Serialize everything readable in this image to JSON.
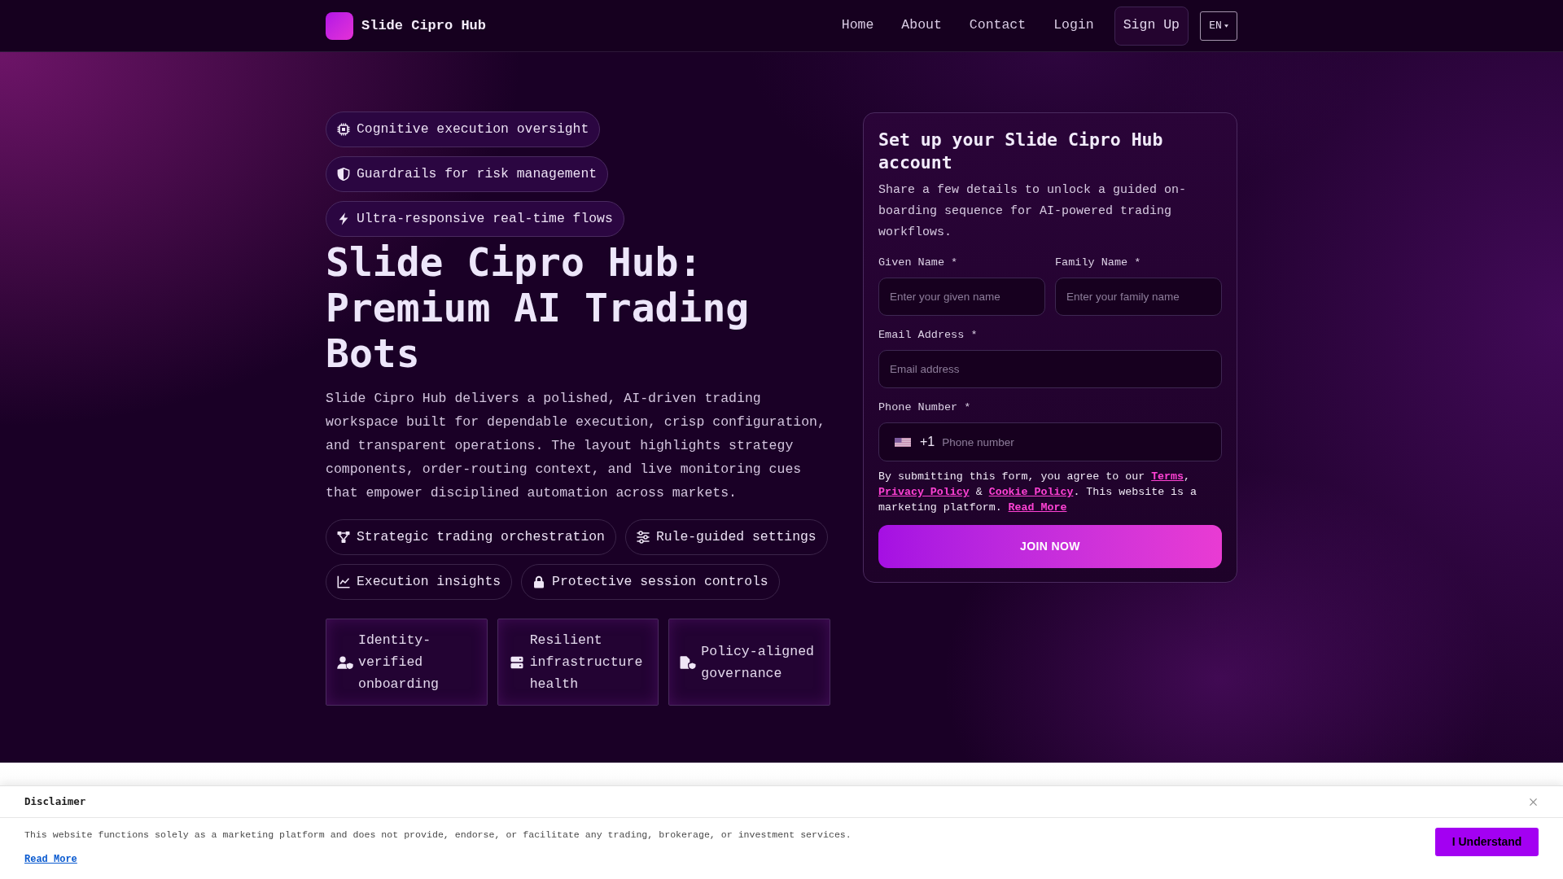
{
  "header": {
    "brand": "Slide Cipro Hub",
    "nav": [
      "Home",
      "About",
      "Contact",
      "Login"
    ],
    "signup": "Sign Up",
    "language": "EN"
  },
  "hero": {
    "badges": [
      "Cognitive execution oversight",
      "Guardrails for risk management",
      "Ultra-responsive real-time flows"
    ],
    "title": "Slide Cipro Hub: Premium AI Trading Bots",
    "description": "Slide Cipro Hub delivers a polished, AI-driven trading workspace built for dependable execution, crisp configuration, and transparent operations. The layout highlights strategy components, order-routing context, and live monitoring cues that empower disciplined automation across markets.",
    "features": [
      "Strategic trading orchestration",
      "Rule-guided settings",
      "Execution insights",
      "Protective session controls"
    ],
    "cards": [
      "Identity-verified onboarding",
      "Resilient infrastructure health",
      "Policy-aligned governance"
    ]
  },
  "form": {
    "title": "Set up your Slide Cipro Hub account",
    "description": "Share a few details to unlock a guided on-boarding sequence for AI-powered trading workflows.",
    "rows": [
      [
        {
          "kind": "text",
          "label": "Given Name *",
          "placeholder": "Enter your given name"
        },
        {
          "kind": "text",
          "label": "Family Name *",
          "placeholder": "Enter your family name"
        }
      ],
      [
        {
          "kind": "email",
          "label": "Email Address *",
          "placeholder": "Email address"
        }
      ],
      [
        {
          "kind": "phone",
          "label": "Phone Number *",
          "country_code": "+1",
          "placeholder": "Phone number"
        }
      ]
    ],
    "consent": [
      {
        "kind": "text",
        "text": "By submitting this form, you agree to our "
      },
      {
        "kind": "link",
        "text": "Terms"
      },
      {
        "kind": "text",
        "text": ", "
      },
      {
        "kind": "link",
        "text": "Privacy Policy"
      },
      {
        "kind": "text",
        "text": " & "
      },
      {
        "kind": "link",
        "text": "Cookie Policy"
      },
      {
        "kind": "text",
        "text": ". This website is a marketing platform. "
      },
      {
        "kind": "link",
        "text": "Read More"
      }
    ],
    "submit": "JOIN NOW"
  },
  "disclaimer": {
    "title": "Disclaimer",
    "text": "This website functions solely as a marketing platform and does not provide, endorse, or facilitate any trading, brokerage, or investment services.",
    "link": "Read More",
    "button": "I Understand"
  }
}
